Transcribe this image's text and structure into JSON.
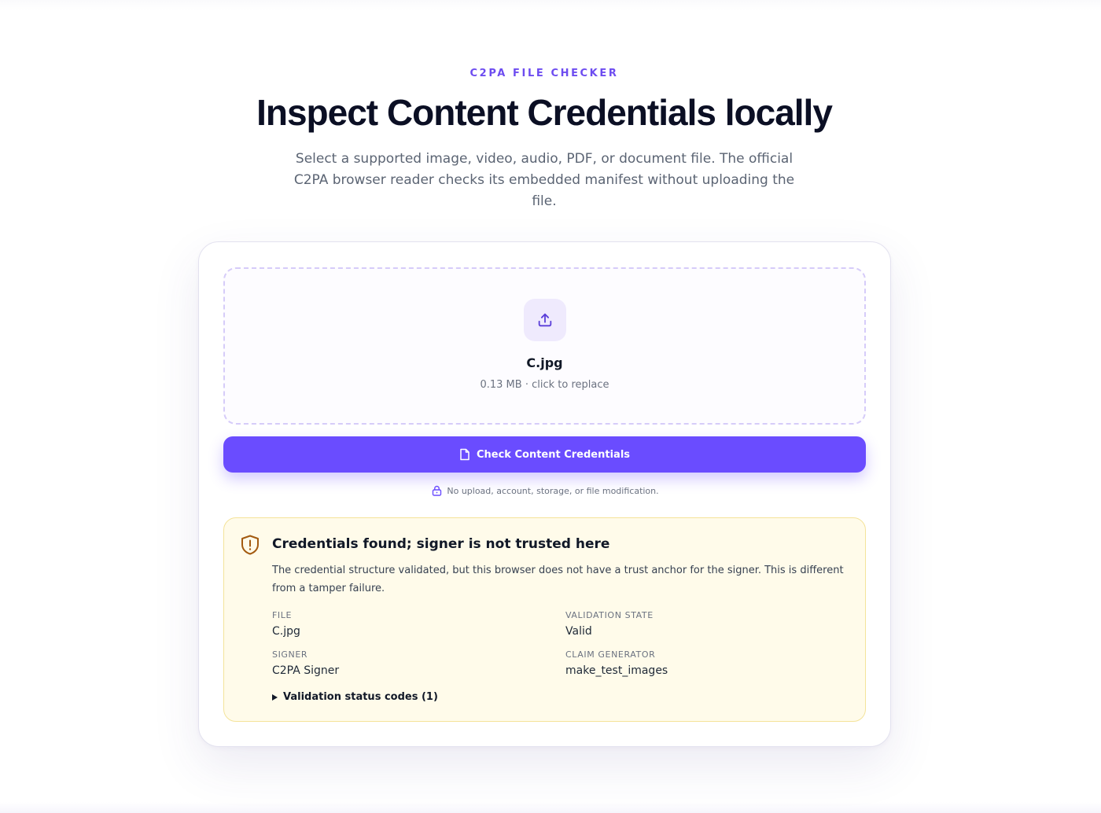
{
  "header": {
    "eyebrow": "C2PA FILE CHECKER",
    "title": "Inspect Content Credentials locally",
    "subtitle": "Select a supported image, video, audio, PDF, or document file. The official C2PA browser reader checks its embedded manifest without uploading the file."
  },
  "dropzone": {
    "icon": "upload-icon",
    "file_name": "C.jpg",
    "file_meta": "0.13 MB · click to replace"
  },
  "check_button": {
    "icon": "document-icon",
    "label": "Check Content Credentials"
  },
  "privacy_note": {
    "icon": "lock-icon",
    "text": "No upload, account, storage, or file modification."
  },
  "result": {
    "icon": "shield-alert-icon",
    "title": "Credentials found; signer is not trusted here",
    "description": "The credential structure validated, but this browser does not have a trust anchor for the signer. This is different from a tamper failure.",
    "fields": {
      "file_label": "FILE",
      "file_value": "C.jpg",
      "validation_label": "VALIDATION STATE",
      "validation_value": "Valid",
      "signer_label": "SIGNER",
      "signer_value": "C2PA Signer",
      "generator_label": "CLAIM GENERATOR",
      "generator_value": "make_test_images"
    },
    "details_label": "Validation status codes (1)"
  },
  "colors": {
    "accent": "#6a4cff",
    "eyebrow": "#6d4cf0",
    "warning_bg": "#fffbea",
    "warning_border": "#f4e39a",
    "warning_icon": "#a35a10"
  }
}
